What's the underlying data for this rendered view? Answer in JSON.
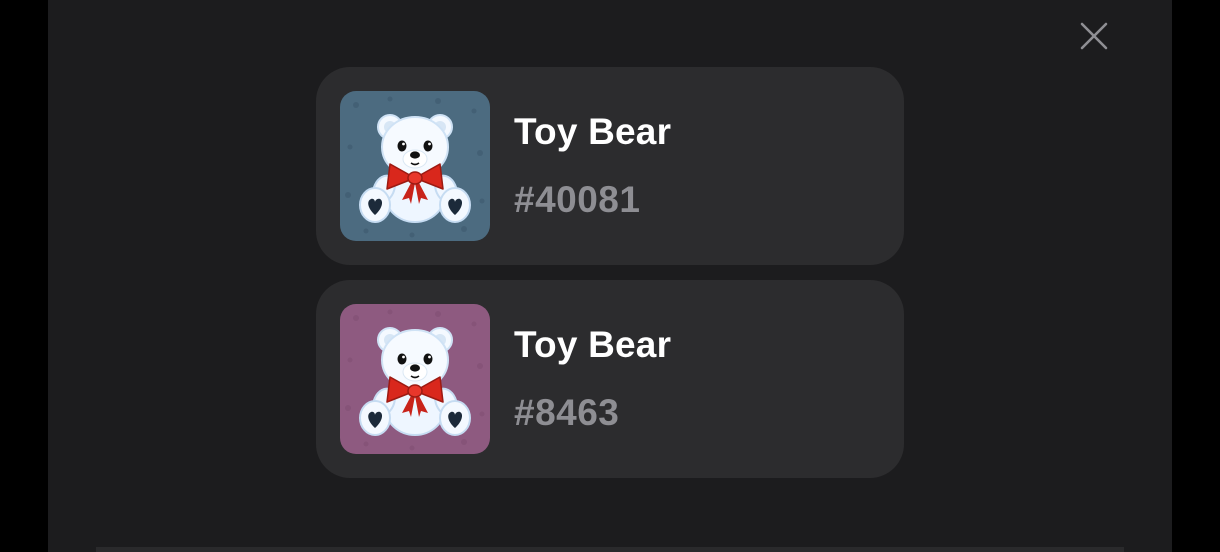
{
  "colors": {
    "background": "#000000",
    "modal": "#1c1c1e",
    "card": "#2c2c2e",
    "title": "#ffffff",
    "subtitle": "#8e8e93"
  },
  "close_icon": "close-icon",
  "items": [
    {
      "title": "Toy Bear",
      "number": "#40081",
      "thumbnail_background": "#4c6b80",
      "icon": "teddy-bear-icon"
    },
    {
      "title": "Toy Bear",
      "number": "#8463",
      "thumbnail_background": "#8e5a80",
      "icon": "teddy-bear-icon"
    }
  ]
}
